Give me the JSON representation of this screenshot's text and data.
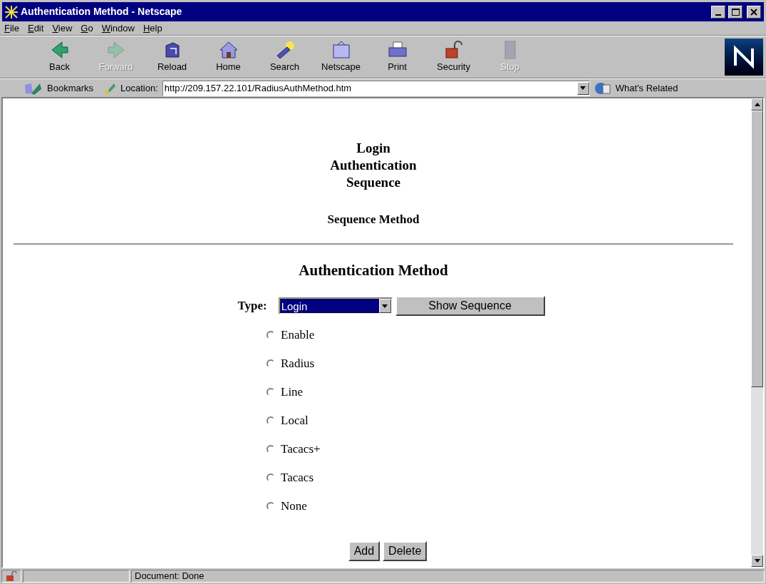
{
  "window": {
    "title": "Authentication Method - Netscape"
  },
  "menu": [
    "File",
    "Edit",
    "View",
    "Go",
    "Window",
    "Help"
  ],
  "toolbar": [
    {
      "label": "Back",
      "kind": "back",
      "disabled": false
    },
    {
      "label": "Forward",
      "kind": "forward",
      "disabled": true
    },
    {
      "label": "Reload",
      "kind": "reload",
      "disabled": false
    },
    {
      "label": "Home",
      "kind": "home",
      "disabled": false
    },
    {
      "label": "Search",
      "kind": "search",
      "disabled": false
    },
    {
      "label": "Netscape",
      "kind": "netscape",
      "disabled": false
    },
    {
      "label": "Print",
      "kind": "print",
      "disabled": false
    },
    {
      "label": "Security",
      "kind": "security",
      "disabled": false
    },
    {
      "label": "Stop",
      "kind": "stop",
      "disabled": true
    }
  ],
  "location_bar": {
    "bookmarks": "Bookmarks",
    "label": "Location:",
    "url": "http://209.157.22.101/RadiusAuthMethod.htm",
    "related": "What's Related"
  },
  "page": {
    "title_lines": [
      "Login",
      "Authentication",
      "Sequence"
    ],
    "subtitle": "Sequence Method",
    "section": "Authentication Method",
    "type_label": "Type:",
    "type_value": "Login",
    "show_button": "Show Sequence",
    "methods": [
      {
        "label": "Enable",
        "selected": false
      },
      {
        "label": "Radius",
        "selected": false
      },
      {
        "label": "Line",
        "selected": false
      },
      {
        "label": "Local",
        "selected": false
      },
      {
        "label": "Tacacs+",
        "selected": false
      },
      {
        "label": "Tacacs",
        "selected": false
      },
      {
        "label": "None",
        "selected": false
      }
    ],
    "buttons": [
      "Add",
      "Delete"
    ]
  },
  "status_bar": {
    "text": "Document: Done"
  }
}
